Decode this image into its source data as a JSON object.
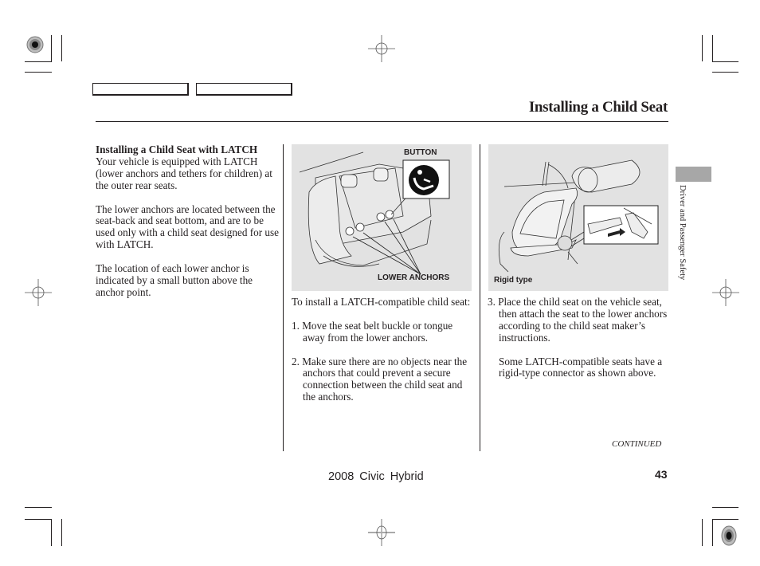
{
  "header": {
    "section_title": "Installing a Child Seat",
    "nav_tabs": [
      {
        "label": ""
      },
      {
        "label": ""
      }
    ]
  },
  "side_tab": {
    "label": "Driver and Passenger Safety",
    "color": "#a7a7a7"
  },
  "column_left": {
    "heading": "Installing a Child Seat with LATCH",
    "paragraphs": [
      "Your vehicle is equipped with LATCH (lower anchors and tethers for children) at the outer rear seats.",
      "The lower anchors are located between the seat-back and seat bottom, and are to be used only with a child seat designed for use with LATCH.",
      "The location of each lower anchor is indicated by a small button above the anchor point."
    ]
  },
  "figure_1": {
    "callout_top": "BUTTON",
    "callout_bottom": "LOWER ANCHORS",
    "icon": "child-seat-anchor-button-icon",
    "background": "#e2e2e2"
  },
  "figure_2": {
    "caption": "Rigid type",
    "background": "#e2e2e2"
  },
  "column_middle": {
    "intro": "To install a LATCH-compatible child seat:",
    "steps": [
      "1. Move the seat belt buckle or tongue away from the lower anchors.",
      "2. Make sure there are no objects near the anchors that could prevent a secure connection between the child seat and the anchors."
    ]
  },
  "column_right": {
    "steps": [
      "3. Place the child seat on the vehicle seat, then attach the seat to the lower anchors according to the child seat maker’s instructions."
    ],
    "note": "Some LATCH-compatible seats have a rigid-type connector as shown above."
  },
  "footer": {
    "continued": "CONTINUED",
    "model": "2008 Civic Hybrid",
    "page_number": "43"
  }
}
